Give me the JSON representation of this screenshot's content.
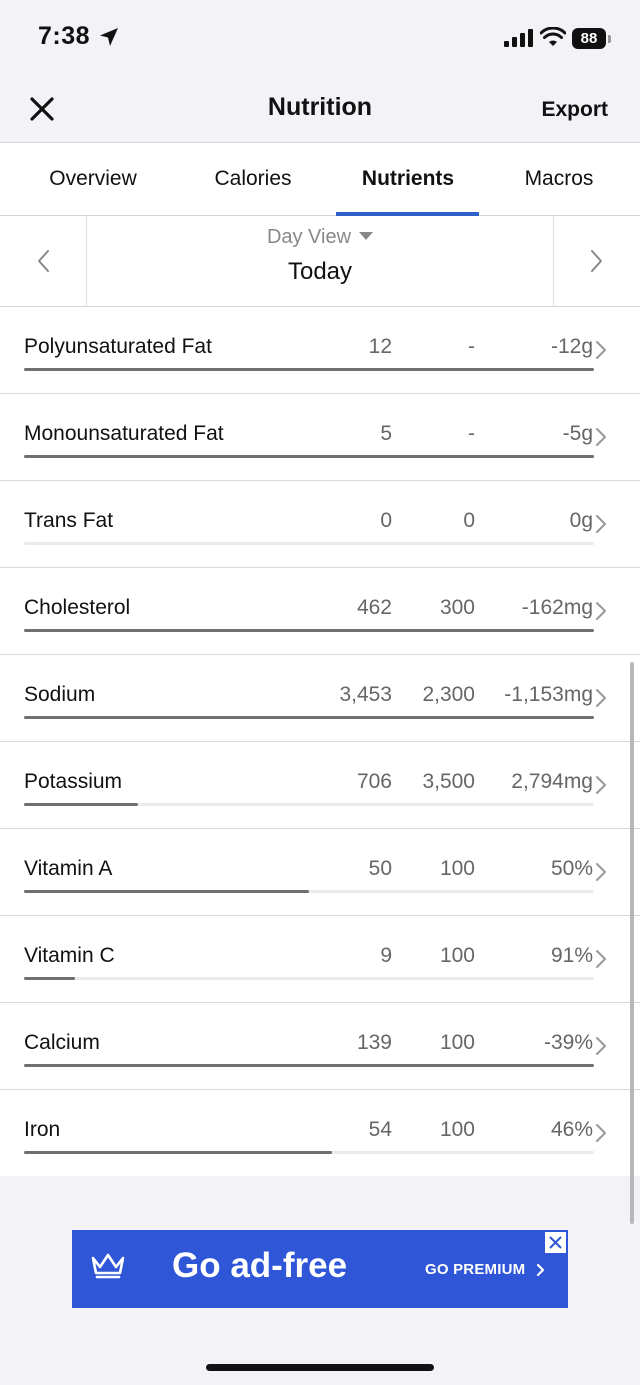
{
  "status_bar": {
    "time": "7:38",
    "battery": "88"
  },
  "navbar": {
    "title": "Nutrition",
    "export_label": "Export"
  },
  "tabs": [
    {
      "label": "Overview"
    },
    {
      "label": "Calories"
    },
    {
      "label": "Nutrients"
    },
    {
      "label": "Macros"
    }
  ],
  "active_tab": "Nutrients",
  "day_selector": {
    "view_label": "Day View",
    "date_label": "Today"
  },
  "nutrients": [
    {
      "name": "Polyunsaturated Fat",
      "total": "12",
      "goal": "-",
      "left": "-12g",
      "progress": 1.0
    },
    {
      "name": "Monounsaturated Fat",
      "total": "5",
      "goal": "-",
      "left": "-5g",
      "progress": 1.0
    },
    {
      "name": "Trans Fat",
      "total": "0",
      "goal": "0",
      "left": "0g",
      "progress": 0.0
    },
    {
      "name": "Cholesterol",
      "total": "462",
      "goal": "300",
      "left": "-162mg",
      "progress": 1.0
    },
    {
      "name": "Sodium",
      "total": "3,453",
      "goal": "2,300",
      "left": "-1,153mg",
      "progress": 1.0
    },
    {
      "name": "Potassium",
      "total": "706",
      "goal": "3,500",
      "left": "2,794mg",
      "progress": 0.2
    },
    {
      "name": "Vitamin A",
      "total": "50",
      "goal": "100",
      "left": "50%",
      "progress": 0.5
    },
    {
      "name": "Vitamin C",
      "total": "9",
      "goal": "100",
      "left": "91%",
      "progress": 0.09
    },
    {
      "name": "Calcium",
      "total": "139",
      "goal": "100",
      "left": "-39%",
      "progress": 1.0
    },
    {
      "name": "Iron",
      "total": "54",
      "goal": "100",
      "left": "46%",
      "progress": 0.54
    }
  ],
  "ad": {
    "headline": "Go ad-free",
    "cta": "GO PREMIUM"
  },
  "colors": {
    "accent": "#2f5fc8",
    "ad_background": "#2e56d6",
    "progress_fill": "#6e6e73"
  }
}
